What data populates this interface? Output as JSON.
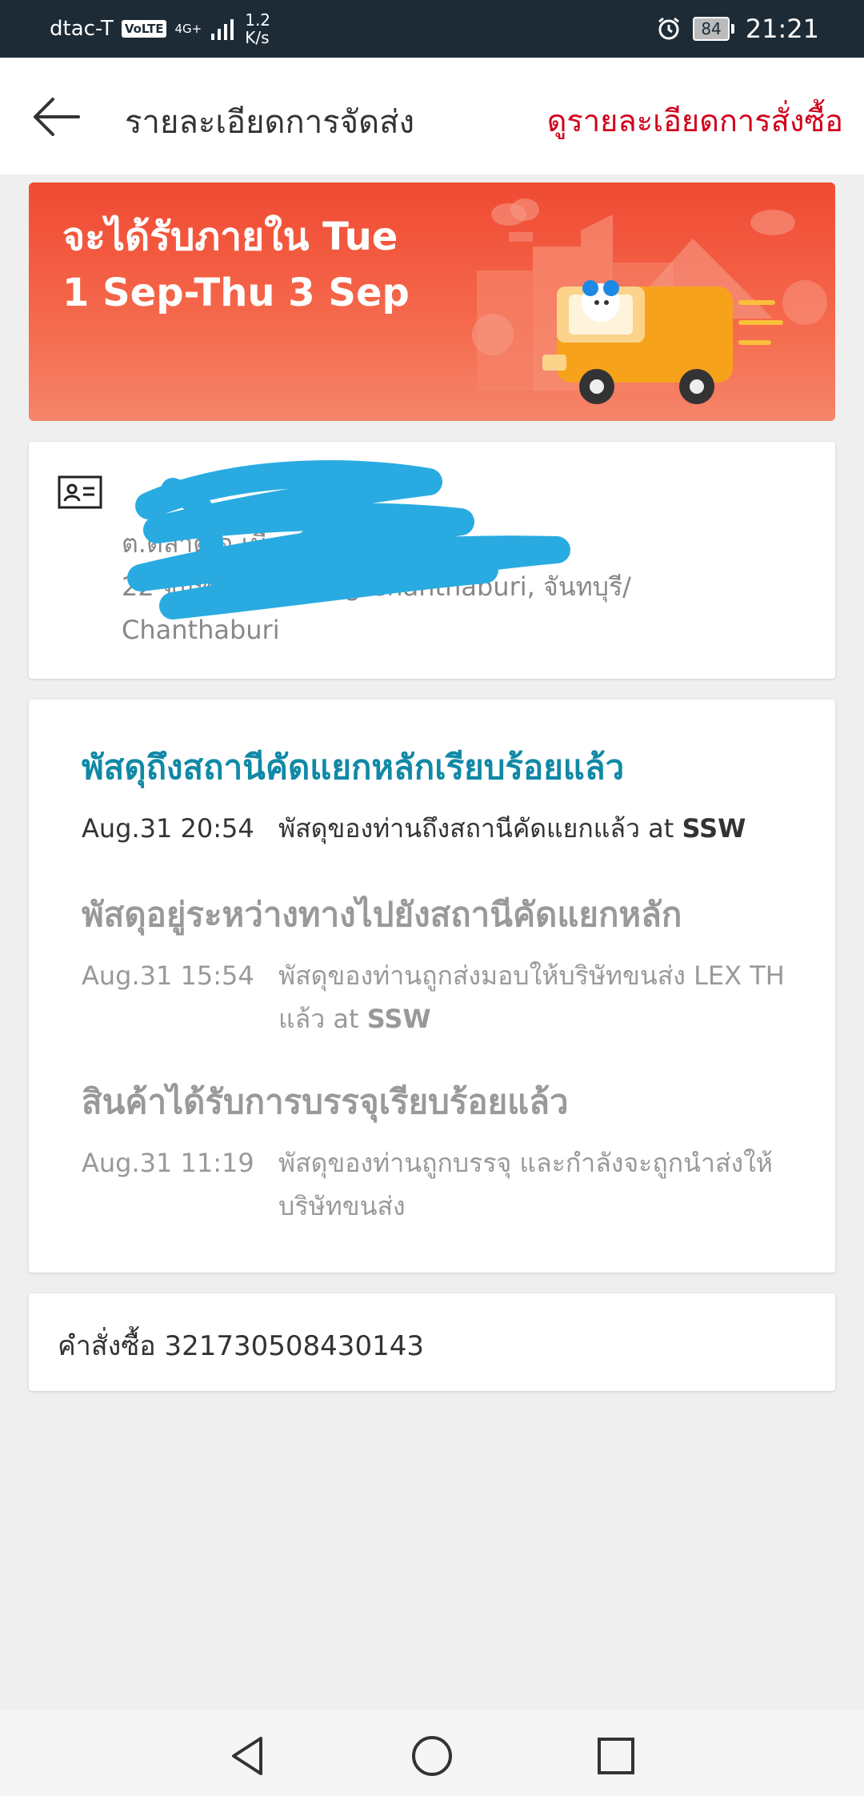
{
  "status": {
    "carrier": "dtac-T",
    "volte": "VoLTE",
    "network": "4G+",
    "speed_value": "1.2",
    "speed_unit": "K/s",
    "battery": "84",
    "time": "21:21"
  },
  "header": {
    "title": "รายละเอียดการจัดส่ง",
    "link": "ดูรายละเอียดการสั่งซื้อ"
  },
  "banner": {
    "line1": "จะได้รับภายใน Tue",
    "line2": "1 Sep-Thu 3 Sep"
  },
  "address": {
    "line1": "ต.ตลาด อ.เมือง จันทบุรี,",
    "line2": "22 จันทบุรี/ Mueang Chanthaburi, จันทบุรี/",
    "line3": "Chanthaburi"
  },
  "tracking": [
    {
      "heading": "พัสดุถึงสถานีคัดแยกหลักเรียบร้อยแล้ว",
      "date": "Aug.31 20:54",
      "desc": "พัสดุของท่านถึงสถานีคัดแยกแล้ว at",
      "hub": "SSW"
    },
    {
      "heading": "พัสดุอยู่ระหว่างทางไปยังสถานีคัดแยกหลัก",
      "date": "Aug.31 15:54",
      "desc": "พัสดุของท่านถูกส่งมอบให้บริษัทขนส่ง LEX TH แล้ว at",
      "hub": "SSW"
    },
    {
      "heading": "สินค้าได้รับการบรรจุเรียบร้อยแล้ว",
      "date": "Aug.31 11:19",
      "desc": "พัสดุของท่านถูกบรรจุ และกำลังจะถูกนำส่งให้บริษัทขนส่ง"
    }
  ],
  "order": {
    "label": "คำสั่งซื้อ 321730508430143"
  },
  "icons": {
    "back": "arrow-left-icon",
    "contact": "contact-card-icon",
    "nav_back": "triangle-back-icon",
    "nav_home": "circle-home-icon",
    "nav_recent": "square-recent-icon"
  },
  "colors": {
    "accent": "#d0011b",
    "banner": "#f04a33",
    "tracking_active": "#1089a6",
    "scribble": "#29abe2"
  }
}
